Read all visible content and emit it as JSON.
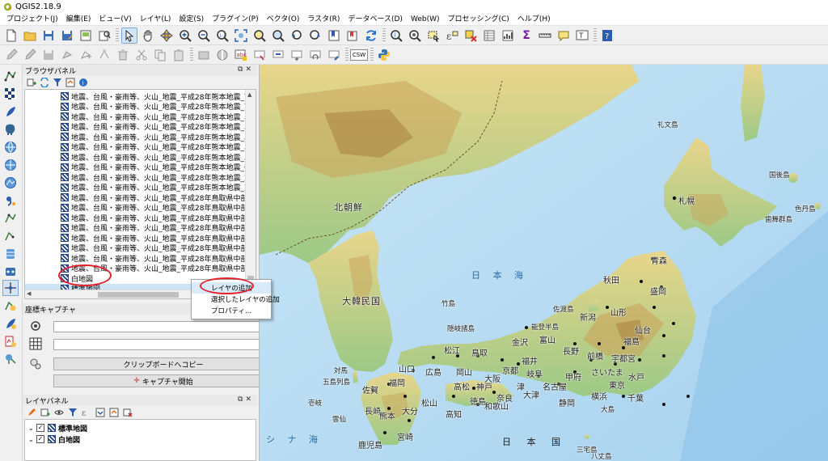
{
  "window": {
    "title": "QGIS2.18.9"
  },
  "menu": {
    "items": [
      "プロジェクト(J)",
      "編集(E)",
      "ビュー(V)",
      "レイヤ(L)",
      "設定(S)",
      "プラグイン(P)",
      "ベクタ(O)",
      "ラスタ(R)",
      "データベース(D)",
      "Web(W)",
      "プロセッシング(C)",
      "ヘルプ(H)"
    ]
  },
  "toolbar": {
    "csw_label": "CSW"
  },
  "browser_panel": {
    "title": "ブラウザパネル",
    "items": [
      "地震、台風・豪雨等、火山_地震_平成28年熊本地震_写真_正射",
      "地震、台風・豪雨等、火山_地震_平成28年熊本地震_写真_正射",
      "地震、台風・豪雨等、火山_地震_平成28年熊本地震_段彩図_傾",
      "地震、台風・豪雨等、火山_地震_平成28年熊本地震_段彩図_傾",
      "地震、台風・豪雨等、火山_地震_平成28年熊本地震_段彩図_傾",
      "地震、台風・豪雨等、火山_地震_平成28年熊本地震_段彩図_傾",
      "地震、台風・豪雨等、火山_地震_平成28年熊本地震_段彩図_傾",
      "地震、台風・豪雨等、火山_地震_平成28年熊本地震_都市圏活",
      "地震、台風・豪雨等、火山_地震_平成28年熊本地震_変動補正",
      "地震、台風・豪雨等、火山_地震_平成28年熊本地震_変動補正",
      "地震、台風・豪雨等、火山_地震_平成28年鳥取県中部の地震_",
      "地震、台風・豪雨等、火山_地震_平成28年鳥取県中部の地震_",
      "地震、台風・豪雨等、火山_地震_平成28年鳥取県中部の地震_",
      "地震、台風・豪雨等、火山_地震_平成28年鳥取県中部の地震_",
      "地震、台風・豪雨等、火山_地震_平成28年鳥取県中部の地震_",
      "地震、台風・豪雨等、火山_地震_平成28年鳥取県中部の地震_",
      "地震、台風・豪雨等、火山_地震_平成28年鳥取県中部の地震_",
      "地震、台風・豪雨等、火山_地震_平成28年鳥取県中部の地震_",
      "白地図",
      "標準地図"
    ],
    "selected_index": 19
  },
  "context_menu": {
    "items": [
      "レイヤの追加",
      "選択したレイヤの追加",
      "プロパティ..."
    ]
  },
  "coord_panel": {
    "title": "座標キャプチャ",
    "field1_value": "",
    "field2_value": "",
    "copy_button": "クリップボードへコピー",
    "start_button": "キャプチャ開始"
  },
  "layers_panel": {
    "title": "レイヤパネル",
    "layers": [
      {
        "name": "標準地図",
        "checked": true
      },
      {
        "name": "白地図",
        "checked": true
      }
    ]
  },
  "map": {
    "labels": {
      "north_korea": "北朝鮮",
      "south_korea": "大韓民国",
      "sea_of_japan": "日 本 海",
      "sapporo": "札幌",
      "rebun": "礼文島",
      "kunashiri": "国後島",
      "shikotan": "色丹島",
      "habomai": "歯舞群島",
      "aomori": "青森",
      "akita": "秋田",
      "morioka": "盛岡",
      "yamagata": "山形",
      "sendai": "仙台",
      "niigata": "新潟",
      "fukushima": "福島",
      "sado": "佐渡島",
      "takeshima": "竹島",
      "oki": "隠岐諸島",
      "noto": "能登半島",
      "kanazawa": "金沢",
      "toyama": "富山",
      "nagano": "長野",
      "maebashi": "前橋",
      "utsunomiya": "宇都宮",
      "mito": "水戸",
      "matsue": "松江",
      "tottori": "鳥取",
      "fukui": "福井",
      "gifu": "岐阜",
      "kofu": "甲府",
      "saitama": "さいたま",
      "tokyo": "東京",
      "chiba": "千葉",
      "yokohama": "横浜",
      "kyoto": "京都",
      "otsu": "大津",
      "nagoya": "名古屋",
      "shizuoka": "静岡",
      "yamaguchi": "山口",
      "hiroshima": "広島",
      "okayama": "岡山",
      "kobe": "神戸",
      "osaka": "大阪",
      "nara": "奈良",
      "tsu": "津",
      "oshima": "大島",
      "fukuoka": "福岡",
      "saga": "佐賀",
      "oita": "大分",
      "matsuyama": "松山",
      "takamatsu": "高松",
      "tokushima": "徳島",
      "kochi": "高知",
      "wakayama": "和歌山",
      "nagasaki": "長崎",
      "kumamoto": "熊本",
      "miyazaki": "宮崎",
      "kagoshima": "鹿児島",
      "goto": "五島列島",
      "tsushima": "対馬",
      "iki": "壱岐",
      "unzen": "雲仙",
      "tsushima_strait": "シ ナ 海",
      "japan": "日 本 国",
      "miyake": "三宅島",
      "hachijo": "八丈島"
    }
  }
}
